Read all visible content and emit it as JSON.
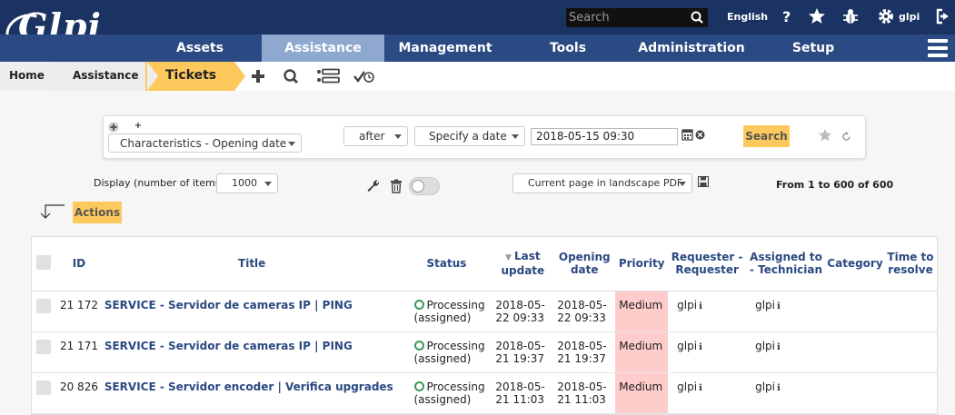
{
  "app": {
    "logo_text": "Glpi"
  },
  "topbar": {
    "search_placeholder": "Search",
    "language": "English",
    "user": "glpi",
    "icons": [
      "search-icon",
      "help-icon",
      "star-icon",
      "bug-icon",
      "gear-icon",
      "logout-icon"
    ]
  },
  "nav": {
    "items": [
      {
        "label": "Assets"
      },
      {
        "label": "Assistance"
      },
      {
        "label": "Management"
      },
      {
        "label": "Tools"
      },
      {
        "label": "Administration"
      },
      {
        "label": "Setup"
      }
    ],
    "active": "Assistance"
  },
  "breadcrumb": {
    "home": "Home",
    "section": "Assistance",
    "current": "Tickets",
    "actions": [
      "add-icon",
      "search-icon",
      "list-icon",
      "check-clock-icon"
    ]
  },
  "criteria": {
    "field": "Characteristics - Opening date",
    "operator": "after",
    "mode": "Specify a date",
    "date_value": "2018-05-15 09:30",
    "search_button": "Search",
    "add_plus": "+"
  },
  "controls": {
    "display_label": "Display (number of items)",
    "display_value": "1000",
    "export_option": "Current page in landscape PDF",
    "pagination": "From 1 to 600 of 600",
    "actions_button": "Actions"
  },
  "table": {
    "columns": [
      "ID",
      "Title",
      "Status",
      "Last update",
      "Opening date",
      "Priority",
      "Requester - Requester",
      "Assigned to - Technician",
      "Category",
      "Time to resolve"
    ],
    "sorted_column": "Last update",
    "rows": [
      {
        "id": "21 172",
        "title": "SERVICE - Servidor de cameras IP | PING",
        "status_line1": "Processing",
        "status_line2": "(assigned)",
        "last_update_1": "2018-05-",
        "last_update_2": "22 09:33",
        "opening_1": "2018-05-",
        "opening_2": "22 09:33",
        "priority": "Medium",
        "requester": "glpi",
        "technician": "glpi",
        "category": "",
        "ttr": ""
      },
      {
        "id": "21 171",
        "title": "SERVICE - Servidor de cameras IP | PING",
        "status_line1": "Processing",
        "status_line2": "(assigned)",
        "last_update_1": "2018-05-",
        "last_update_2": "21 19:37",
        "opening_1": "2018-05-",
        "opening_2": "21 19:37",
        "priority": "Medium",
        "requester": "glpi",
        "technician": "glpi",
        "category": "",
        "ttr": ""
      },
      {
        "id": "20 826",
        "title": "SERVICE - Servidor encoder | Verifica upgrades",
        "status_line1": "Processing",
        "status_line2": "(assigned)",
        "last_update_1": "2018-05-",
        "last_update_2": "21 11:03",
        "opening_1": "2018-05-",
        "opening_2": "21 11:03",
        "priority": "Medium",
        "requester": "glpi",
        "technician": "glpi",
        "category": "",
        "ttr": ""
      }
    ]
  },
  "colors": {
    "topbar": "#1b3363",
    "nav": "#2b4982",
    "nav_active": "#8fa8cf",
    "accent": "#fec95c",
    "priority_medium": "#ffcccc",
    "status_green": "#3a9a5a"
  }
}
